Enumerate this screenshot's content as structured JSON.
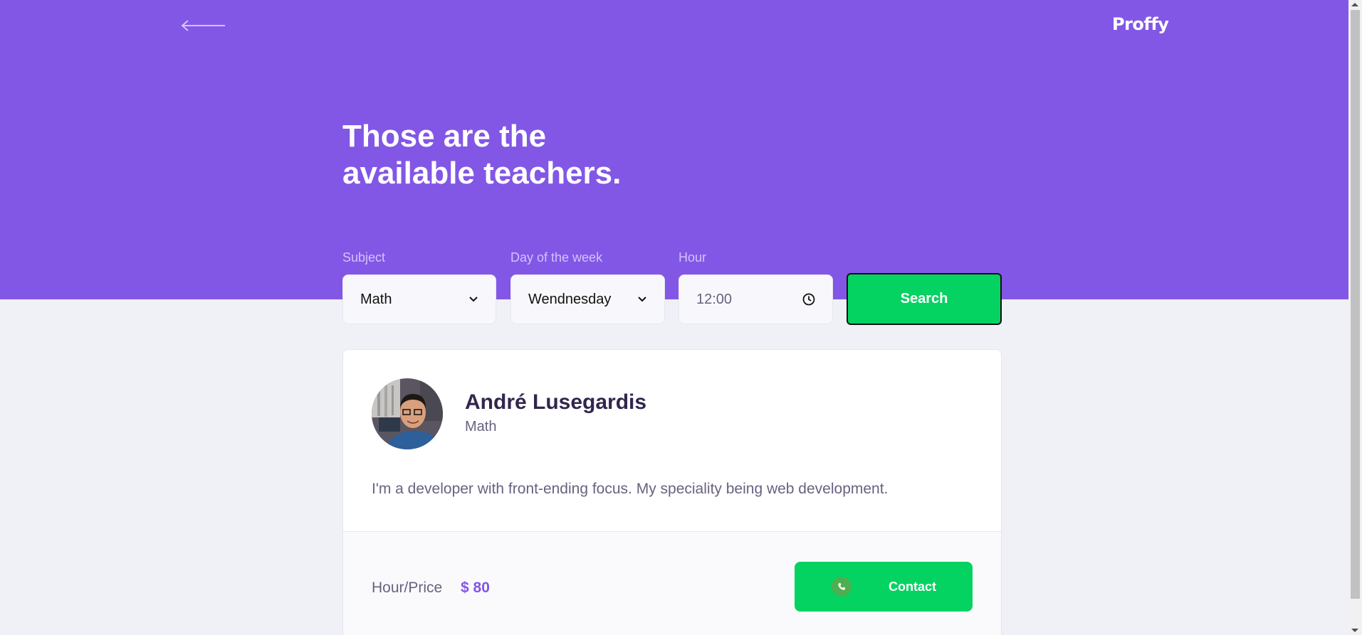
{
  "header": {
    "logo": "Proffy",
    "back_icon": "arrow-left-icon"
  },
  "page_title": "Those are the available teachers.",
  "filters": {
    "subject": {
      "label": "Subject",
      "value": "Math"
    },
    "day": {
      "label": "Day of the week",
      "value": "Wendnesday"
    },
    "hour": {
      "label": "Hour",
      "value": "12:00"
    },
    "search_label": "Search"
  },
  "teacher": {
    "name": "André Lusegardis",
    "subject": "Math",
    "bio": "I'm a developer with front-ending focus. My speciality being web development.",
    "price_label": "Hour/Price",
    "price_value": "$ 80",
    "contact_label": "Contact"
  },
  "colors": {
    "primary": "#8257E5",
    "secondary": "#04D361",
    "background": "#F0F0F7"
  }
}
